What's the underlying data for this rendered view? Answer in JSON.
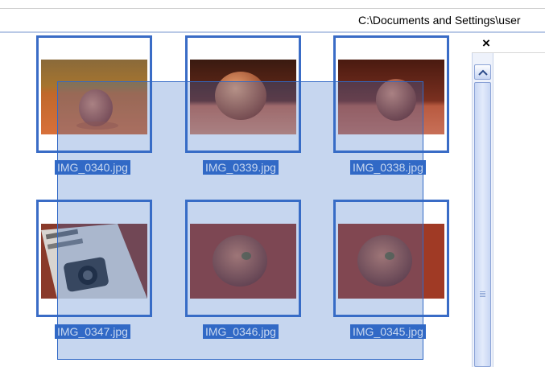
{
  "address_bar": {
    "path": "C:\\Documents and Settings\\user"
  },
  "side_panel": {
    "close_label": "×"
  },
  "thumbnails": [
    {
      "filename": "IMG_0340.jpg"
    },
    {
      "filename": "IMG_0339.jpg"
    },
    {
      "filename": "IMG_0338.jpg"
    },
    {
      "filename": "IMG_0347.jpg"
    },
    {
      "filename": "IMG_0346.jpg"
    },
    {
      "filename": "IMG_0345.jpg"
    }
  ],
  "colors": {
    "selection_blue": "#3169c6",
    "thumb_border": "#3a6cc6"
  }
}
